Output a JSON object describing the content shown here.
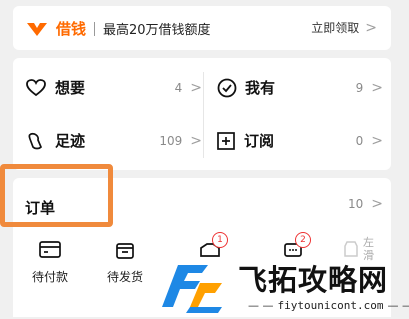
{
  "jiekuan": {
    "brand": "借钱",
    "slogan": "最高20万借钱额度",
    "action": "立即领取",
    "brand_color": "#ff6a00"
  },
  "grid": {
    "want": {
      "label": "想要",
      "count": "4",
      "icon": "heart-icon"
    },
    "owned": {
      "label": "我有",
      "count": "9",
      "icon": "check-circle-icon"
    },
    "footprint": {
      "label": "足迹",
      "count": "109",
      "icon": "footprint-icon"
    },
    "subscribe": {
      "label": "订阅",
      "count": "0",
      "icon": "plus-square-icon"
    }
  },
  "orders": {
    "title": "订单",
    "count": "10",
    "highlight_color": "#f08a3c",
    "items": [
      {
        "label": "待付款",
        "icon": "wallet-icon",
        "badge": ""
      },
      {
        "label": "待发货",
        "icon": "box-icon",
        "badge": ""
      },
      {
        "label": "",
        "icon": "truck-icon",
        "badge": "1"
      },
      {
        "label": "",
        "icon": "chat-icon",
        "badge": "2"
      },
      {
        "label": "左滑",
        "icon": "refresh-icon",
        "badge": ""
      }
    ]
  },
  "watermark": {
    "title": "飞拓攻略网",
    "url": "fiytounicont.com"
  }
}
